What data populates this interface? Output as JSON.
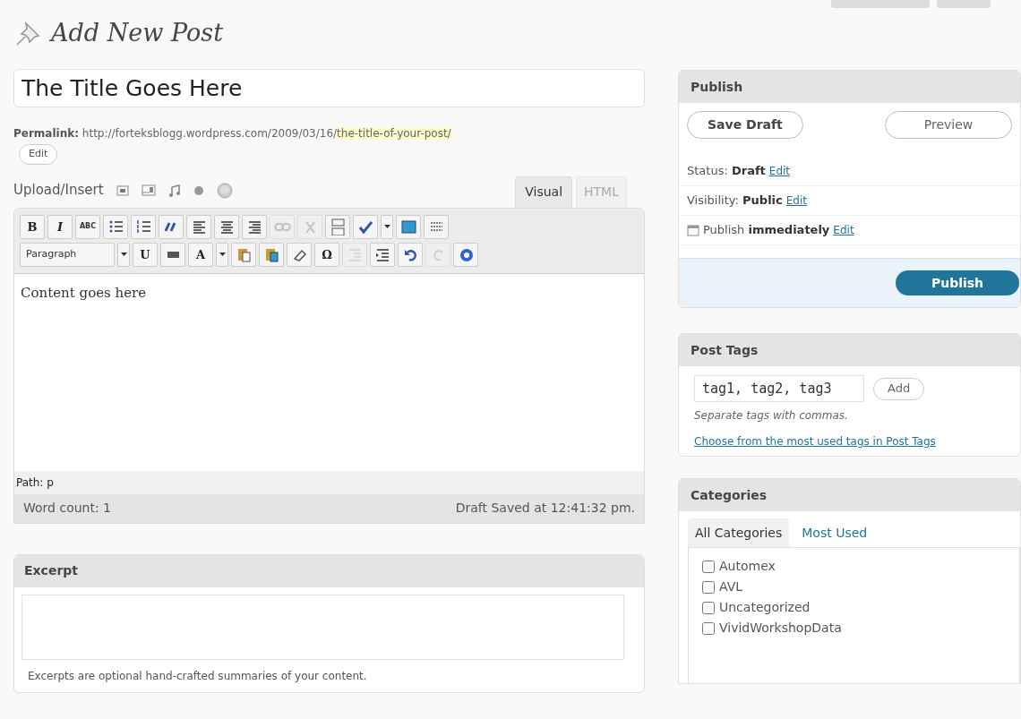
{
  "page_title": "Add New Post",
  "post_title": "The Title Goes Here",
  "permalink": {
    "label": "Permalink:",
    "base": "http://forteksblogg.wordpress.com/2009/03/16/",
    "slug": "the-title-of-your-post/",
    "edit": "Edit"
  },
  "upload_insert": "Upload/Insert",
  "editor_tabs": [
    {
      "label": "Visual",
      "selected": true
    },
    {
      "label": "HTML",
      "selected": false
    }
  ],
  "toolbar_rows": [
    [
      {
        "kind": "text",
        "label": "B",
        "disabled": false
      },
      {
        "kind": "text",
        "label": "I",
        "disabled": false
      },
      {
        "kind": "text",
        "label": "ABC",
        "disabled": false
      },
      {
        "kind": "icon",
        "disabled": false
      },
      {
        "kind": "icon",
        "disabled": false
      },
      {
        "kind": "icon",
        "disabled": false
      },
      {
        "kind": "icon",
        "disabled": false
      },
      {
        "kind": "icon",
        "disabled": false
      },
      {
        "kind": "icon",
        "disabled": false
      },
      {
        "kind": "icon",
        "disabled": true
      },
      {
        "kind": "icon",
        "disabled": true
      },
      {
        "kind": "icon",
        "disabled": false
      },
      {
        "kind": "icon",
        "disabled": false
      },
      {
        "kind": "caret",
        "disabled": false
      },
      {
        "kind": "icon",
        "disabled": false
      },
      {
        "kind": "icon",
        "disabled": false
      }
    ],
    [
      {
        "kind": "select",
        "label": "Paragraph",
        "disabled": false
      },
      {
        "kind": "caret",
        "disabled": false
      },
      {
        "kind": "text",
        "label": "U",
        "disabled": false
      },
      {
        "kind": "icon",
        "disabled": false
      },
      {
        "kind": "text",
        "label": "A",
        "disabled": false
      },
      {
        "kind": "caret",
        "disabled": false
      },
      {
        "kind": "icon",
        "disabled": false
      },
      {
        "kind": "icon",
        "disabled": false
      },
      {
        "kind": "icon",
        "disabled": false
      },
      {
        "kind": "text",
        "label": "Ω",
        "disabled": false
      },
      {
        "kind": "icon",
        "disabled": true
      },
      {
        "kind": "icon",
        "disabled": false
      },
      {
        "kind": "icon",
        "disabled": false
      },
      {
        "kind": "icon",
        "disabled": true
      },
      {
        "kind": "icon",
        "disabled": false
      }
    ]
  ],
  "content": "Content goes here",
  "path": "Path: p",
  "word_count": "Word count: 1",
  "draft_saved": "Draft Saved at 12:41:32 pm.",
  "excerpt": {
    "title": "Excerpt",
    "hint": "Excerpts are optional hand-crafted summaries of your content."
  },
  "publish": {
    "title": "Publish",
    "save_draft": "Save Draft",
    "preview": "Preview",
    "rows": [
      {
        "kind": "plain",
        "label": "Status:",
        "value": "Draft",
        "edit": "Edit"
      },
      {
        "kind": "plain",
        "label": "Visibility:",
        "value": "Public",
        "edit": "Edit"
      },
      {
        "kind": "calendar",
        "label": "Publish",
        "value": "immediately",
        "edit": "Edit"
      }
    ],
    "button": "Publish"
  },
  "post_tags": {
    "title": "Post Tags",
    "value": "tag1, tag2, tag3",
    "add": "Add",
    "hint": "Separate tags with commas.",
    "link": "Choose from the most used tags in Post Tags"
  },
  "categories": {
    "title": "Categories",
    "tabs": [
      {
        "label": "All Categories",
        "selected": true
      },
      {
        "label": "Most Used",
        "selected": false
      }
    ],
    "items": [
      {
        "label": "Automex",
        "checked": false
      },
      {
        "label": "AVL",
        "checked": false
      },
      {
        "label": "Uncategorized",
        "checked": false
      },
      {
        "label": "VividWorkshopData",
        "checked": false
      }
    ]
  }
}
